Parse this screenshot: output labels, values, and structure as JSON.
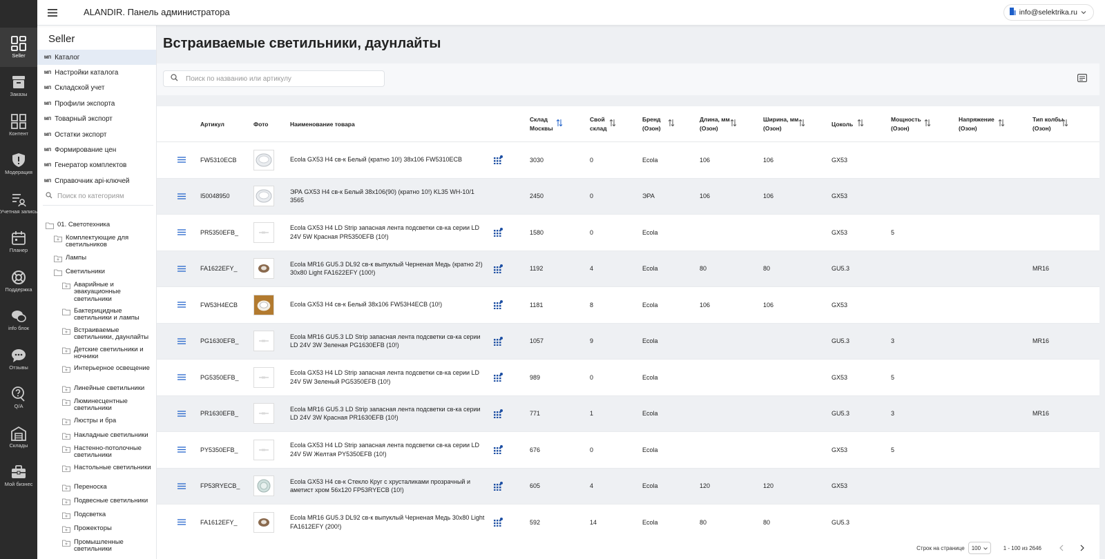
{
  "header": {
    "title": "ALANDIR. Панель администратора",
    "user_email": "info@selektrika.ru"
  },
  "rail": [
    {
      "label": "Seller",
      "icon": "grid-icon",
      "active": true
    },
    {
      "label": "Заказы",
      "icon": "box-icon"
    },
    {
      "label": "Контент",
      "icon": "content-icon"
    },
    {
      "label": "Модерация",
      "icon": "shield-icon"
    },
    {
      "label": "Учетная запись",
      "icon": "account-icon"
    },
    {
      "label": "Планер",
      "icon": "calendar-icon"
    },
    {
      "label": "Поддержка",
      "icon": "lifebuoy-icon"
    },
    {
      "label": "info блок",
      "icon": "chat-icon"
    },
    {
      "label": "Отзывы",
      "icon": "reviews-icon"
    },
    {
      "label": "Q/A",
      "icon": "qa-icon"
    },
    {
      "label": "Склады",
      "icon": "warehouse-icon"
    },
    {
      "label": "Мой бизнес",
      "icon": "briefcase-icon"
    }
  ],
  "sidebar": {
    "title": "Seller",
    "mp_badge": "МП",
    "menu": [
      {
        "label": "Каталог",
        "active": true
      },
      {
        "label": "Настройки каталога"
      },
      {
        "label": "Складской учет"
      },
      {
        "label": "Профили экспорта"
      },
      {
        "label": "Товарный экспорт"
      },
      {
        "label": "Остатки экспорт"
      },
      {
        "label": "Формирование цен"
      },
      {
        "label": "Генератор комплектов"
      },
      {
        "label": "Справочник api-ключей"
      }
    ],
    "search_placeholder": "Поиск по категориям",
    "tree": [
      {
        "label": "01. Светотехника",
        "level": 0,
        "plus": false
      },
      {
        "label": "Комплектующие для светильников",
        "level": 1,
        "plus": true
      },
      {
        "label": "Лампы",
        "level": 1,
        "plus": true
      },
      {
        "label": "Светильники",
        "level": 1,
        "plus": false
      },
      {
        "label": "Аварийные и эвакуационные светильники",
        "level": 2,
        "plus": true
      },
      {
        "label": "Бактерицидные светильники и лампы",
        "level": 2,
        "plus": false
      },
      {
        "label": "Встраиваемые светильники, даунлайты",
        "level": 2,
        "plus": true
      },
      {
        "label": "Детские светильники и ночники",
        "level": 2,
        "plus": true
      },
      {
        "label": "Интерьерное освещение",
        "level": 2,
        "plus": true
      },
      {
        "label": "Линейные светильники",
        "level": 2,
        "plus": true
      },
      {
        "label": "Люминесцентные светильники",
        "level": 2,
        "plus": true
      },
      {
        "label": "Люстры и бра",
        "level": 2,
        "plus": true
      },
      {
        "label": "Накладные светильники",
        "level": 2,
        "plus": true
      },
      {
        "label": "Настенно-потолочные светильники",
        "level": 2,
        "plus": true
      },
      {
        "label": "Настольные светильники",
        "level": 2,
        "plus": true
      },
      {
        "label": "Переноска",
        "level": 2,
        "plus": true
      },
      {
        "label": "Подвесные светильники",
        "level": 2,
        "plus": true
      },
      {
        "label": "Подсветка",
        "level": 2,
        "plus": true
      },
      {
        "label": "Прожекторы",
        "level": 2,
        "plus": true
      },
      {
        "label": "Промышленные светильники",
        "level": 2,
        "plus": true
      }
    ]
  },
  "main": {
    "title": "Встраиваемые светильники, даунлайты",
    "search_placeholder": "Поиск по названию или артикулу"
  },
  "table": {
    "columns": {
      "article": "Артикул",
      "photo": "Фото",
      "name": "Наименование товара",
      "stock_msk": "Склад\nМосквы",
      "own_stock": "Свой\nсклад",
      "brand": "Бренд\n(Озон)",
      "length": "Длина, мм\n(Озон)",
      "width": "Ширина, мм\n(Озон)",
      "base": "Цоколь",
      "power": "Мощность\n(Озон)",
      "voltage": "Напряжение\n(Озон)",
      "bulb": "Тип колбы\n(Озон)"
    },
    "rows": [
      {
        "article": "FW5310ECB",
        "name": "Ecola GX53 H4 св-к Белый (кратно 10!) 38x106 FW5310ECB",
        "stock": "3030",
        "own": "0",
        "brand": "Ecola",
        "length": "106",
        "width": "106",
        "base": "GX53",
        "power": "",
        "bulb": "",
        "badge": true,
        "thumb": "round-white"
      },
      {
        "article": "I50048950",
        "name": "ЭРА GX53 H4 св-к Белый 38x106(90) (кратно 10!) KL35 WH-10/1 3565",
        "stock": "2450",
        "own": "0",
        "brand": "ЭРА",
        "length": "106",
        "width": "106",
        "base": "GX53",
        "power": "",
        "bulb": "",
        "badge": false,
        "thumb": "round-white"
      },
      {
        "article": "PR5350EFB_",
        "name": "Ecola GX53 H4 LD Strip запасная лента подсветки св-ка серии LD 24V 5W Красная PR5350EFB (10!)",
        "stock": "1580",
        "own": "0",
        "brand": "Ecola",
        "length": "",
        "width": "",
        "base": "GX53",
        "power": "5",
        "bulb": "",
        "badge": true,
        "thumb": "strip"
      },
      {
        "article": "FA1622EFY_",
        "name": "Ecola MR16 GU5.3 DL92 св-к выпуклый Черненая Медь (кратно 2!) 30x80 Light FA1622EFY (100!)",
        "stock": "1192",
        "own": "4",
        "brand": "Ecola",
        "length": "80",
        "width": "80",
        "base": "GU5.3",
        "power": "",
        "bulb": "MR16",
        "badge": true,
        "thumb": "copper"
      },
      {
        "article": "FW53H4ECB",
        "name": "Ecola GX53 H4 св-к Белый 38x106 FW53H4ECB (10!)",
        "stock": "1181",
        "own": "8",
        "brand": "Ecola",
        "length": "106",
        "width": "106",
        "base": "GX53",
        "power": "",
        "bulb": "",
        "badge": true,
        "thumb": "box"
      },
      {
        "article": "PG1630EFB_",
        "name": "Ecola MR16 GU5.3 LD Strip запасная лента подсветки св-ка серии LD 24V 3W Зеленая PG1630EFB (10!)",
        "stock": "1057",
        "own": "9",
        "brand": "Ecola",
        "length": "",
        "width": "",
        "base": "GU5.3",
        "power": "3",
        "bulb": "MR16",
        "badge": true,
        "thumb": "strip"
      },
      {
        "article": "PG5350EFB_",
        "name": "Ecola GX53 H4 LD Strip запасная лента подсветки св-ка серии LD 24V 5W Зеленый PG5350EFB (10!)",
        "stock": "989",
        "own": "0",
        "brand": "Ecola",
        "length": "",
        "width": "",
        "base": "GX53",
        "power": "5",
        "bulb": "",
        "badge": true,
        "thumb": "strip"
      },
      {
        "article": "PR1630EFB_",
        "name": "Ecola MR16 GU5.3 LD Strip запасная лента подсветки св-ка серии LD 24V 3W Красная PR1630EFB (10!)",
        "stock": "771",
        "own": "1",
        "brand": "Ecola",
        "length": "",
        "width": "",
        "base": "GU5.3",
        "power": "3",
        "bulb": "MR16",
        "badge": true,
        "thumb": "strip"
      },
      {
        "article": "PY5350EFB_",
        "name": "Ecola GX53 H4 LD Strip запасная лента подсветки св-ка серии LD 24V 5W Желтая PY5350EFB (10!)",
        "stock": "676",
        "own": "0",
        "brand": "Ecola",
        "length": "",
        "width": "",
        "base": "GX53",
        "power": "5",
        "bulb": "",
        "badge": true,
        "thumb": "strip"
      },
      {
        "article": "FP53RYECB_",
        "name": "Ecola GX53 H4 св-к Стекло Круг с хрусталиками прозрачный и аметист хром 56x120 FP53RYECB (10!)",
        "stock": "605",
        "own": "4",
        "brand": "Ecola",
        "length": "120",
        "width": "120",
        "base": "GX53",
        "power": "",
        "bulb": "",
        "badge": true,
        "thumb": "crystal"
      },
      {
        "article": "FA1612EFY_",
        "name": "Ecola MR16 GU5.3 DL92 св-к выпуклый Черненая Медь 30x80 Light FA1612EFY (200!)",
        "stock": "592",
        "own": "14",
        "brand": "Ecola",
        "length": "80",
        "width": "80",
        "base": "GU5.3",
        "power": "",
        "bulb": "",
        "badge": true,
        "thumb": "copper"
      }
    ]
  },
  "footer": {
    "rows_per_page_label": "Строк на странице",
    "rows_per_page": "100",
    "range": "1 - 100 из 2646"
  },
  "colors": {
    "accent": "#1d5fc9",
    "rail": "#2b2b2b",
    "active_menu": "#e4ebf5"
  }
}
